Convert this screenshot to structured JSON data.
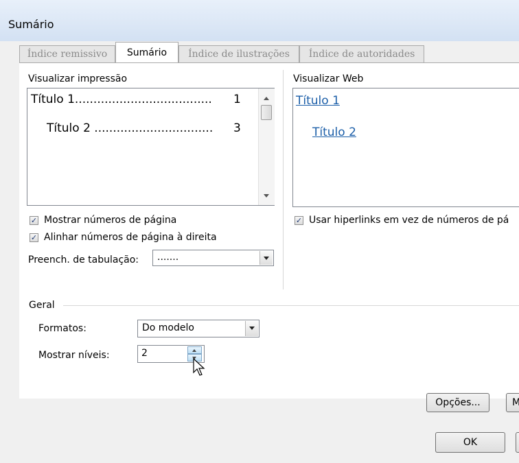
{
  "window": {
    "title": "Sumário"
  },
  "tabs": [
    {
      "label": "Índice remissivo",
      "active": false
    },
    {
      "label": "Sumário",
      "active": true
    },
    {
      "label": "Índice de ilustrações",
      "active": false
    },
    {
      "label": "Índice de autoridades",
      "active": false
    }
  ],
  "print_preview": {
    "label": "Visualizar impressão",
    "lines": [
      {
        "text": "Título 1.....................................",
        "page": "1"
      },
      {
        "text": "Título 2 ................................",
        "page": "3"
      }
    ]
  },
  "web_preview": {
    "label": "Visualizar Web",
    "links": [
      "Título 1",
      "Título 2"
    ]
  },
  "options": {
    "show_page_numbers": {
      "label": "Mostrar números de página",
      "checked": true
    },
    "right_align": {
      "label": "Alinhar números de página à direita",
      "checked": true
    },
    "hyperlinks": {
      "label": "Usar hiperlinks em vez de números de pá",
      "checked": true
    },
    "tab_leader": {
      "label": "Preench. de tabulação:",
      "value": "......."
    }
  },
  "general": {
    "legend": "Geral",
    "formats": {
      "label": "Formatos:",
      "value": "Do modelo"
    },
    "levels": {
      "label": "Mostrar níveis:",
      "value": "2"
    }
  },
  "buttons": {
    "options": "Opções...",
    "modify": "M",
    "ok": "OK"
  },
  "colors": {
    "link": "#1b5ea8",
    "check": "#203a73"
  }
}
